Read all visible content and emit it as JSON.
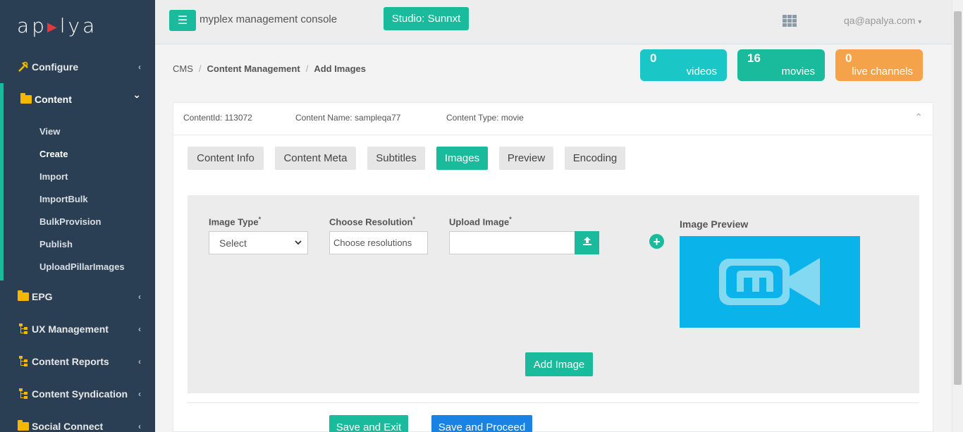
{
  "brand": {
    "logo_text_left": "ap",
    "logo_text_right": "lya",
    "logo_mark": "▶"
  },
  "sidebar": {
    "items": [
      {
        "label": "Configure",
        "icon": "wrench-icon"
      },
      {
        "label": "Content",
        "icon": "folder-icon"
      },
      {
        "label": "EPG",
        "icon": "folder-icon"
      },
      {
        "label": "UX Management",
        "icon": "sitemap-icon"
      },
      {
        "label": "Content Reports",
        "icon": "sitemap-icon"
      },
      {
        "label": "Content Syndication",
        "icon": "sitemap-icon"
      },
      {
        "label": "Social Connect",
        "icon": "folder-icon"
      }
    ],
    "content_sub": [
      "View",
      "Create",
      "Import",
      "ImportBulk",
      "BulkProvision",
      "Publish",
      "UploadPillarImages"
    ],
    "chevron_left": "‹",
    "chevron_down": "⌄"
  },
  "header": {
    "menu_icon": "☰",
    "console_title": "myplex management console",
    "studio_label": "Studio: Sunnxt",
    "user": "qa@apalya.com",
    "user_caret": "▾"
  },
  "breadcrumb": {
    "root": "CMS",
    "section": "Content Management",
    "page": "Add Images",
    "sep": "/"
  },
  "stats": [
    {
      "count": "0",
      "label": "videos",
      "color": "#1ac6c6"
    },
    {
      "count": "16",
      "label": "movies",
      "color": "#1abb9c"
    },
    {
      "count": "0",
      "label": "live channels",
      "color": "#f5a34b"
    }
  ],
  "content_info": {
    "id": "ContentId: 113072",
    "name": "Content Name: sampleqa77",
    "type": "Content Type: movie",
    "collapse_icon": "⌃"
  },
  "tabs": [
    "Content Info",
    "Content Meta",
    "Subtitles",
    "Images",
    "Preview",
    "Encoding"
  ],
  "active_tab": "Images",
  "form": {
    "image_type_label": "Image Type",
    "image_type_value": "Select",
    "resolution_label": "Choose Resolution",
    "resolution_value": "Choose resolutions",
    "upload_label": "Upload Image",
    "required_mark": "*",
    "preview_label": "Image Preview",
    "add_image_label": "Add Image",
    "plus_icon": "+",
    "caret_icon": "⌄"
  },
  "actions": {
    "save_exit": "Save and Exit",
    "save_proceed": "Save and Proceed"
  }
}
